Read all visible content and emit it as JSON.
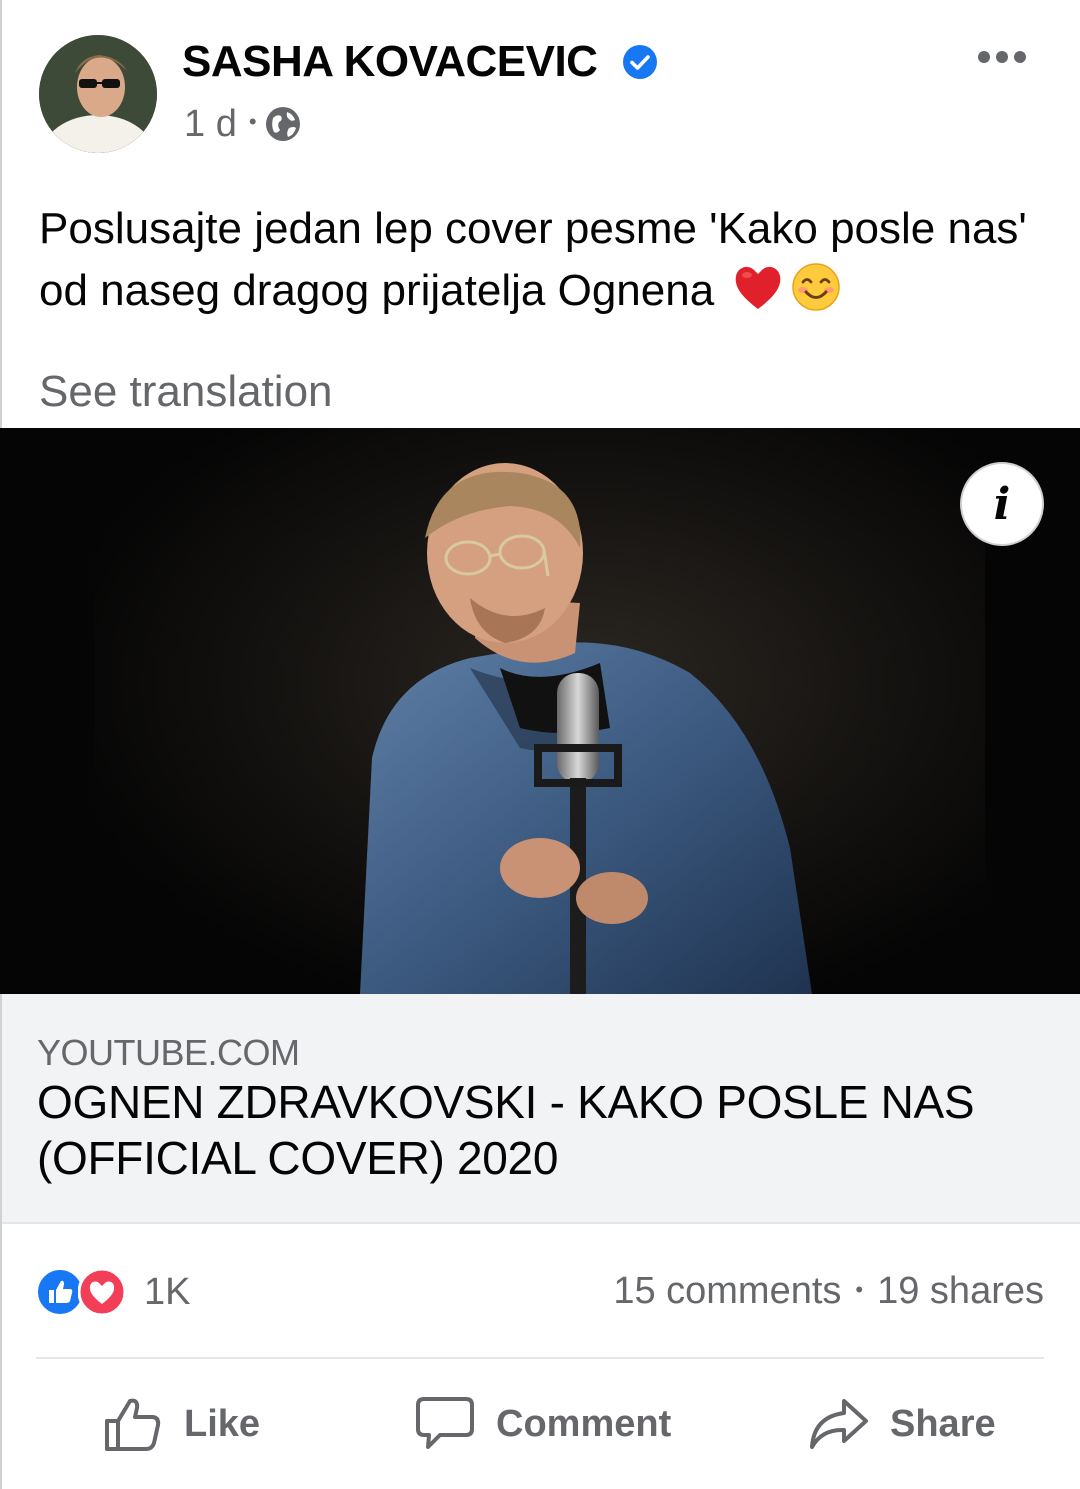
{
  "post": {
    "author": "SASHA KOVACEVIC",
    "time": "1 d",
    "separator": "•",
    "text": "Poslusajte jedan lep cover pesme 'Kako posle nas' od naseg dragog prijatelja Ognena",
    "see_translation": "See translation"
  },
  "icons": {
    "more": "more-options-icon",
    "verified": "verified-badge-icon",
    "audience": "globe-icon",
    "info": "info-icon",
    "emojis": [
      "red-heart-emoji",
      "smiling-face-emoji"
    ]
  },
  "media": {
    "info_label": "i"
  },
  "link_preview": {
    "domain": "YOUTUBE.COM",
    "title": "OGNEN ZDRAVKOVSKI - KAKO POSLE NAS (OFFICIAL COVER) 2020"
  },
  "stats": {
    "reactions": "1K",
    "comments": "15 comments",
    "separator": "•",
    "shares": "19 shares"
  },
  "actions": {
    "like": "Like",
    "comment": "Comment",
    "share": "Share"
  },
  "colors": {
    "text_primary": "#050505",
    "text_secondary": "#65676b",
    "verified_blue": "#1877f2",
    "love_red": "#f33e58",
    "preview_bg": "#f2f3f5"
  }
}
